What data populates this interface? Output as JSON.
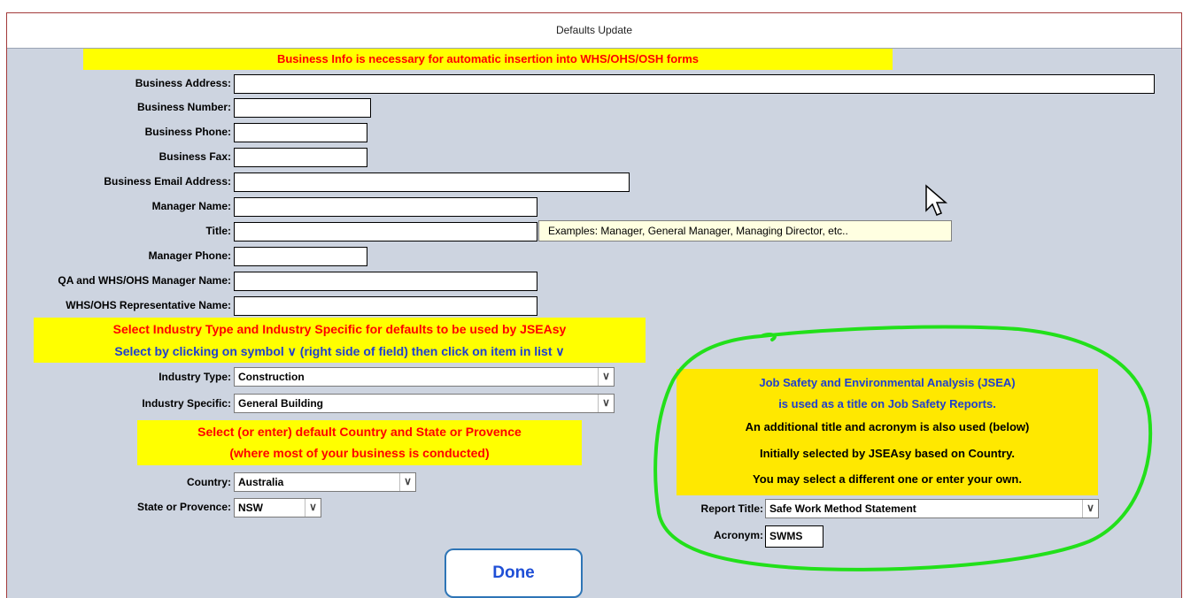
{
  "window": {
    "title": "Defaults Update"
  },
  "banners": {
    "business_info": "Business Info is necessary for automatic insertion into WHS/OHS/OSH forms",
    "industry_line1": "Select Industry Type and Industry Specific for defaults to be used by JSEAsy",
    "industry_line2": "Select by clicking on symbol ∨ (right side of field) then click on item in list  ∨",
    "country_line1": "Select (or enter) default Country and State or Provence",
    "country_line2": "(where most of your business is conducted)"
  },
  "fields": {
    "business_address": {
      "label": "Business Address:",
      "value": ""
    },
    "business_number": {
      "label": "Business Number:",
      "value": ""
    },
    "business_phone": {
      "label": "Business Phone:",
      "value": ""
    },
    "business_fax": {
      "label": "Business Fax:",
      "value": ""
    },
    "business_email": {
      "label": "Business Email Address:",
      "value": ""
    },
    "manager_name": {
      "label": "Manager Name:",
      "value": ""
    },
    "title": {
      "label": "Title:",
      "value": ""
    },
    "manager_phone": {
      "label": "Manager Phone:",
      "value": ""
    },
    "qa_manager_name": {
      "label": "QA and WHS/OHS Manager Name:",
      "value": ""
    },
    "whs_rep_name": {
      "label": "WHS/OHS Representative Name:",
      "value": ""
    }
  },
  "tooltip": {
    "text": "Examples:  Manager, General Manager, Managing Director, etc.."
  },
  "selects": {
    "industry_type": {
      "label": "Industry Type:",
      "value": "Construction"
    },
    "industry_specific": {
      "label": "Industry Specific:",
      "value": "General Building"
    },
    "country": {
      "label": "Country:",
      "value": "Australia"
    },
    "state": {
      "label": "State or Provence:",
      "value": "NSW"
    },
    "report_title": {
      "label": "Report Title:",
      "value": "Safe Work Method Statement"
    }
  },
  "acronym": {
    "label": "Acronym:",
    "value": "SWMS"
  },
  "jsea_panel": {
    "line1": "Job Safety and Environmental Analysis (JSEA)",
    "line2": "is used as a title on Job Safety Reports.",
    "line3": "An additional title and acronym is also used (below)",
    "line4": "Initially selected by JSEAsy based on Country.",
    "line5": "You may select a different one or enter your own."
  },
  "buttons": {
    "done": "Done"
  },
  "colors": {
    "form_background": "#cdd4e0",
    "banner_yellow": "#ffff00",
    "banner_red_text": "#ff0000",
    "blue_text": "#1f3fd0",
    "annotation_green": "#22e01a",
    "done_border": "#2e75b6"
  },
  "icons": {
    "dropdown": "chevron-down-icon",
    "cursor": "mouse-pointer-icon"
  }
}
